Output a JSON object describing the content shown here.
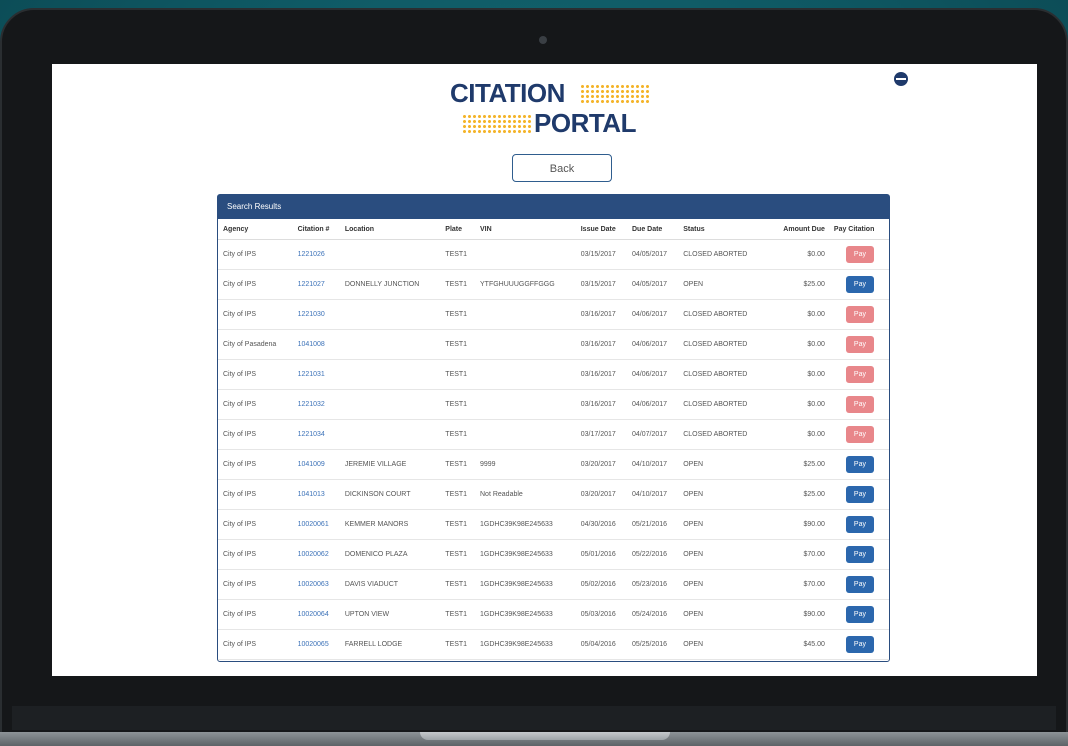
{
  "portal": {
    "logo_line1": "CITATION",
    "logo_line2": "PORTAL",
    "back_label": "Back",
    "panel_title": "Search Results"
  },
  "table": {
    "headers": [
      "Agency",
      "Citation #",
      "Location",
      "Plate",
      "VIN",
      "Issue Date",
      "Due Date",
      "Status",
      "Amount Due",
      "Pay Citation"
    ],
    "rows": [
      {
        "agency": "City of IPS",
        "citation": "1221026",
        "location": "",
        "plate": "TEST1",
        "vin": "",
        "issue": "03/15/2017",
        "due": "04/05/2017",
        "status": "CLOSED ABORTED",
        "amount": "$0.00",
        "pay": "Pay",
        "pay_enabled": false
      },
      {
        "agency": "City of IPS",
        "citation": "1221027",
        "location": "DONNELLY JUNCTION",
        "plate": "TEST1",
        "vin": "YTFGHUUUGGFFGGG",
        "issue": "03/15/2017",
        "due": "04/05/2017",
        "status": "OPEN",
        "amount": "$25.00",
        "pay": "Pay",
        "pay_enabled": true
      },
      {
        "agency": "City of IPS",
        "citation": "1221030",
        "location": "",
        "plate": "TEST1",
        "vin": "",
        "issue": "03/16/2017",
        "due": "04/06/2017",
        "status": "CLOSED ABORTED",
        "amount": "$0.00",
        "pay": "Pay",
        "pay_enabled": false
      },
      {
        "agency": "City of Pasadena",
        "citation": "1041008",
        "location": "",
        "plate": "TEST1",
        "vin": "",
        "issue": "03/16/2017",
        "due": "04/06/2017",
        "status": "CLOSED ABORTED",
        "amount": "$0.00",
        "pay": "Pay",
        "pay_enabled": false
      },
      {
        "agency": "City of IPS",
        "citation": "1221031",
        "location": "",
        "plate": "TEST1",
        "vin": "",
        "issue": "03/16/2017",
        "due": "04/06/2017",
        "status": "CLOSED ABORTED",
        "amount": "$0.00",
        "pay": "Pay",
        "pay_enabled": false
      },
      {
        "agency": "City of IPS",
        "citation": "1221032",
        "location": "",
        "plate": "TEST1",
        "vin": "",
        "issue": "03/16/2017",
        "due": "04/06/2017",
        "status": "CLOSED ABORTED",
        "amount": "$0.00",
        "pay": "Pay",
        "pay_enabled": false
      },
      {
        "agency": "City of IPS",
        "citation": "1221034",
        "location": "",
        "plate": "TEST1",
        "vin": "",
        "issue": "03/17/2017",
        "due": "04/07/2017",
        "status": "CLOSED ABORTED",
        "amount": "$0.00",
        "pay": "Pay",
        "pay_enabled": false
      },
      {
        "agency": "City of IPS",
        "citation": "1041009",
        "location": "JEREMIE VILLAGE",
        "plate": "TEST1",
        "vin": "9999",
        "issue": "03/20/2017",
        "due": "04/10/2017",
        "status": "OPEN",
        "amount": "$25.00",
        "pay": "Pay",
        "pay_enabled": true
      },
      {
        "agency": "City of IPS",
        "citation": "1041013",
        "location": "DICKINSON COURT",
        "plate": "TEST1",
        "vin": "Not Readable",
        "issue": "03/20/2017",
        "due": "04/10/2017",
        "status": "OPEN",
        "amount": "$25.00",
        "pay": "Pay",
        "pay_enabled": true
      },
      {
        "agency": "City of IPS",
        "citation": "10020061",
        "location": "KEMMER MANORS",
        "plate": "TEST1",
        "vin": "1GDHC39K98E245633",
        "issue": "04/30/2016",
        "due": "05/21/2016",
        "status": "OPEN",
        "amount": "$90.00",
        "pay": "Pay",
        "pay_enabled": true
      },
      {
        "agency": "City of IPS",
        "citation": "10020062",
        "location": "DOMENICO PLAZA",
        "plate": "TEST1",
        "vin": "1GDHC39K98E245633",
        "issue": "05/01/2016",
        "due": "05/22/2016",
        "status": "OPEN",
        "amount": "$70.00",
        "pay": "Pay",
        "pay_enabled": true
      },
      {
        "agency": "City of IPS",
        "citation": "10020063",
        "location": "DAVIS VIADUCT",
        "plate": "TEST1",
        "vin": "1GDHC39K98E245633",
        "issue": "05/02/2016",
        "due": "05/23/2016",
        "status": "OPEN",
        "amount": "$70.00",
        "pay": "Pay",
        "pay_enabled": true
      },
      {
        "agency": "City of IPS",
        "citation": "10020064",
        "location": "UPTON VIEW",
        "plate": "TEST1",
        "vin": "1GDHC39K98E245633",
        "issue": "05/03/2016",
        "due": "05/24/2016",
        "status": "OPEN",
        "amount": "$90.00",
        "pay": "Pay",
        "pay_enabled": true
      },
      {
        "agency": "City of IPS",
        "citation": "10020065",
        "location": "FARRELL LODGE",
        "plate": "TEST1",
        "vin": "1GDHC39K98E245633",
        "issue": "05/04/2016",
        "due": "05/25/2016",
        "status": "OPEN",
        "amount": "$45.00",
        "pay": "Pay",
        "pay_enabled": true
      }
    ]
  },
  "colors": {
    "brand_navy": "#1f3a6b",
    "accent_gold": "#f4b42a",
    "pay_enabled": "#2b67ad",
    "pay_disabled": "#e8868a",
    "panel_header": "#2a4d7f"
  },
  "icons": {
    "top_right": "globe-icon"
  }
}
